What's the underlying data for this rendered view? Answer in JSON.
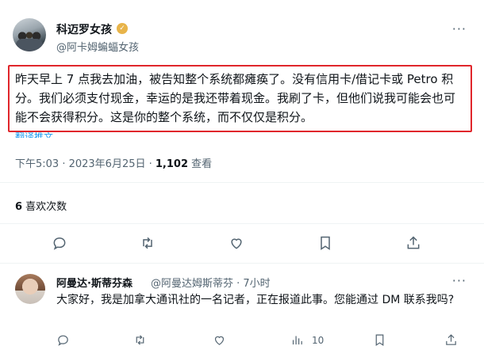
{
  "tweet": {
    "author_name": "科迈罗女孩",
    "author_handle": "@阿卡姆蝙蝠女孩",
    "text": "昨天早上 7 点我去加油，被告知整个系统都瘫痪了。没有信用卡/借记卡或 Petro 积分。我们必须支付现金，幸运的是我还带着现金。我刷了卡，但他们说我可能会也可能不会获得积分。这是你的整个系统，而不仅仅是积分。",
    "translate_label": "翻译推文",
    "timestamp": "下午5:03 · 2023年6月25日 · ",
    "views_count": "1,102",
    "views_label": " 查看",
    "likes_count": "6",
    "likes_label": " 喜欢次数",
    "more_label": "···"
  },
  "reply": {
    "author_name": "阿曼达·斯蒂芬森",
    "meta": "@阿曼达姆斯蒂芬 · 7小时",
    "text": "大家好，我是加拿大通讯社的一名记者，正在报道此事。您能通过 DM 联系我吗?",
    "views_count": "10",
    "more_label": "···"
  },
  "colors": {
    "highlight_border": "#e0262b",
    "link": "#1d9bf0",
    "muted": "#536471",
    "verified_badge": "#e8b44a"
  },
  "icons": [
    "reply-icon",
    "retweet-icon",
    "like-icon",
    "bookmark-icon",
    "share-icon",
    "views-icon",
    "more-icon",
    "verified-badge-icon"
  ]
}
